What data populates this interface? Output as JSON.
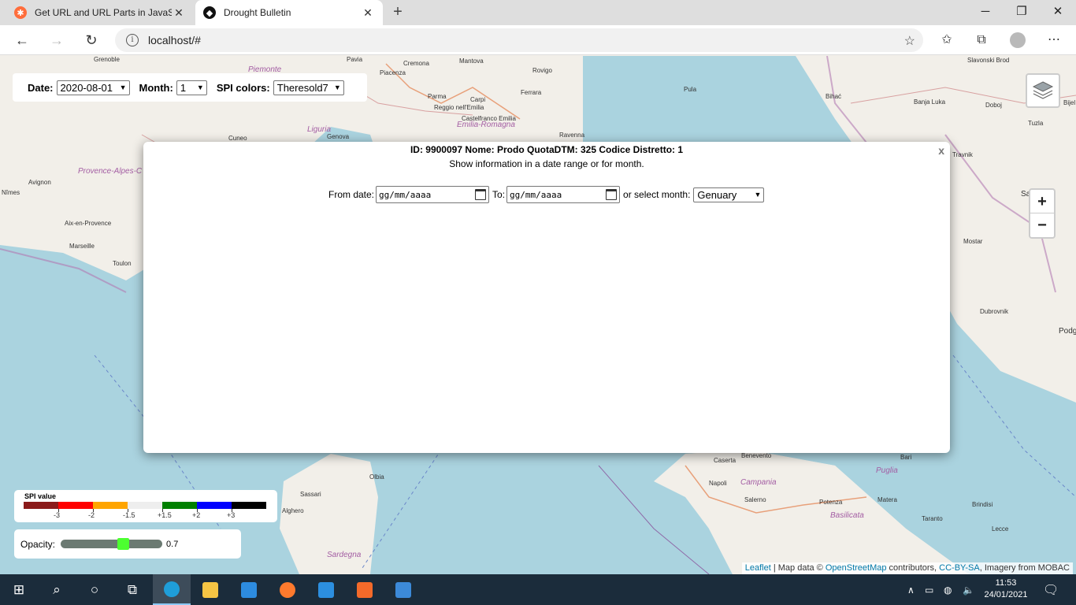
{
  "browser": {
    "tabs": [
      {
        "title": "Get URL and URL Parts in JavaSc",
        "icon": "firebase-flame-icon",
        "active": false
      },
      {
        "title": "Drought Bulletin",
        "icon": "bulletin-logo-icon",
        "active": true
      }
    ],
    "url": "localhost/#"
  },
  "controls": {
    "date_label": "Date:",
    "date_value": "2020-08-01",
    "month_label": "Month:",
    "month_value": "1",
    "spi_label": "SPI colors:",
    "spi_value": "Theresold7"
  },
  "popup": {
    "close": "x",
    "header": "ID: 9900097 Nome: Prodo QuotaDTM: 325 Codice Distretto: 1",
    "subtitle": "Show information in a date range or for month.",
    "from_label": "From date:",
    "from_placeholder": "gg/mm/aaaa",
    "to_label": "To:",
    "to_placeholder": "gg/mm/aaaa",
    "month_label": "or select month:",
    "month_value": "Genuary"
  },
  "legend": {
    "title": "SPI value",
    "colors": [
      "#8b1a1a",
      "#ff0000",
      "#ffa500",
      "#eeeeee",
      "#008000",
      "#0000ff",
      "#000000"
    ],
    "ticks": [
      "-3",
      "-2",
      "-1.5",
      "+1.5",
      "+2",
      "+3"
    ]
  },
  "opacity": {
    "label": "Opacity:",
    "value": "0.7",
    "fraction": 0.7
  },
  "attribution": {
    "leaflet": "Leaflet",
    "sep": " | Map data © ",
    "osm": "OpenStreetMap",
    "contrib": " contributors, ",
    "license": "CC-BY-SA",
    "imagery": ", Imagery from MOBAC"
  },
  "map_labels": {
    "grenoble": "Grenoble",
    "pavia": "Pavia",
    "cremona": "Cremona",
    "mantova": "Mantova",
    "rovigo": "Rovigo",
    "piacenza": "Piacenza",
    "piemonte": "Piemonte",
    "parma": "Parma",
    "carpi": "Carpi",
    "reggio": "Reggio nell'Emilia",
    "ferrara": "Ferrara",
    "castelfranco": "Castelfranco Emilia",
    "emilia": "Emilia-Romagna",
    "ravenna": "Ravenna",
    "liguria": "Liguria",
    "cuneo": "Cuneo",
    "genova": "Genova",
    "pula": "Pula",
    "bihac": "Bihać",
    "banja": "Banja Luka",
    "doboj": "Doboj",
    "tuzla": "Tuzla",
    "slavonski": "Slavonski Brod",
    "bijel": "Bijel",
    "travnik": "Travnik",
    "sarajevo": "Sarajevo",
    "mostar": "Mostar",
    "dubrovnik": "Dubrovnik",
    "podg": "Podg",
    "provence": "Provence-Alpes-C",
    "avignon": "Avignon",
    "nimes": "Nîmes",
    "aix": "Aix-en-Provence",
    "marseille": "Marseille",
    "toulon": "Toulon",
    "caserta": "Caserta",
    "benevento": "Benevento",
    "bari": "Bari",
    "puglia": "Puglia",
    "napoli": "Napoli",
    "campania": "Campania",
    "salerno": "Salerno",
    "potenza": "Potenza",
    "matera": "Matera",
    "brindisi": "Brindisi",
    "basilicata": "Basilicata",
    "taranto": "Taranto",
    "lecce": "Lecce",
    "olbia": "Olbia",
    "sassari": "Sassari",
    "alghero": "Alghero",
    "sardegna": "Sardegna"
  },
  "taskbar": {
    "time": "11:53",
    "date": "24/01/2021"
  }
}
